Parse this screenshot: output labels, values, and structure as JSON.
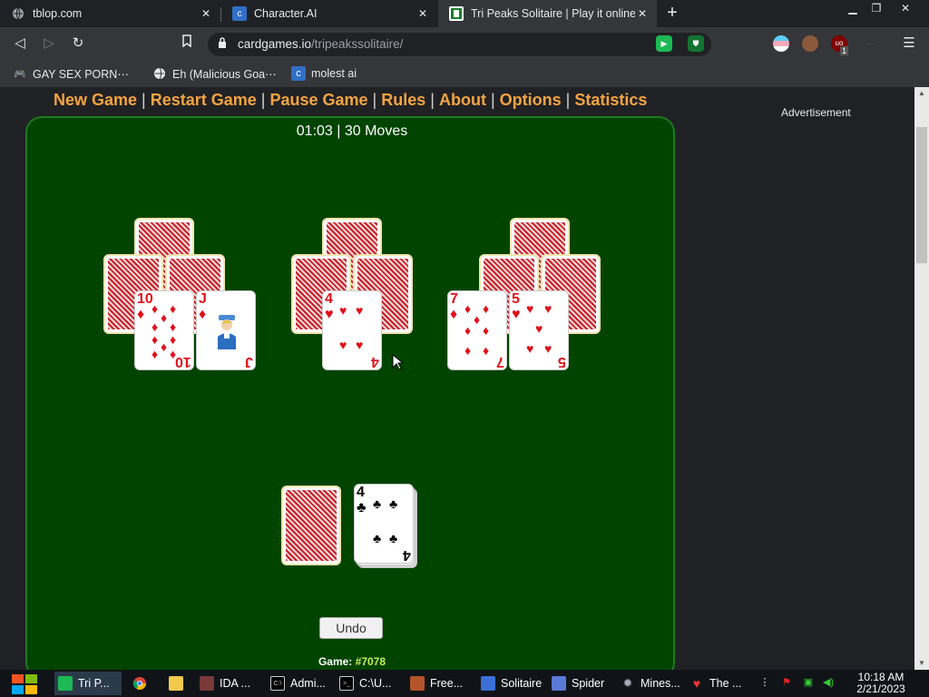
{
  "browser": {
    "tabs": [
      {
        "title": "tblop.com",
        "active": false
      },
      {
        "title": "Character.AI",
        "active": false
      },
      {
        "title": "Tri Peaks Solitaire | Play it online",
        "active": true
      }
    ],
    "url_host": "cardgames.io",
    "url_path": "/tripeakssolitaire/",
    "bookmarks": [
      {
        "label": "GAY SEX PORN⋯"
      },
      {
        "label": "Eh (Malicious Goa⋯"
      },
      {
        "label": "molest ai"
      }
    ],
    "extension_badge": "1"
  },
  "game": {
    "menu": [
      "New Game",
      "Restart Game",
      "Pause Game",
      "Rules",
      "About",
      "Options",
      "Statistics"
    ],
    "status": "01:03 | 30 Moves",
    "undo_label": "Undo",
    "game_label": "Game:",
    "game_number": "#7078",
    "cards": {
      "peak1_left": {
        "rank": "10",
        "suit": "♦",
        "color": "red"
      },
      "peak1_right": {
        "rank": "J",
        "suit": "♦",
        "color": "red"
      },
      "peak2": {
        "rank": "4",
        "suit": "♥",
        "color": "red"
      },
      "peak3_left": {
        "rank": "7",
        "suit": "♦",
        "color": "red"
      },
      "peak3_right": {
        "rank": "5",
        "suit": "♥",
        "color": "red"
      },
      "waste": {
        "rank": "4",
        "suit": "♣",
        "color": "black"
      }
    }
  },
  "sidebar": {
    "advertisement": "Advertisement"
  },
  "taskbar": {
    "items": [
      {
        "label": "Tri P..."
      },
      {
        "label": ""
      },
      {
        "label": ""
      },
      {
        "label": "IDA ..."
      },
      {
        "label": "Admi..."
      },
      {
        "label": "C:\\U..."
      },
      {
        "label": "Free..."
      },
      {
        "label": "Solitaire"
      },
      {
        "label": "Spider"
      },
      {
        "label": "Mines..."
      },
      {
        "label": "The ..."
      }
    ],
    "time": "10:18 AM",
    "date": "2/21/2023"
  },
  "colors": {
    "table_green": "#004400",
    "menu_orange": "#f5a442",
    "card_red": "#e0101a",
    "game_number": "#c3f05a"
  }
}
